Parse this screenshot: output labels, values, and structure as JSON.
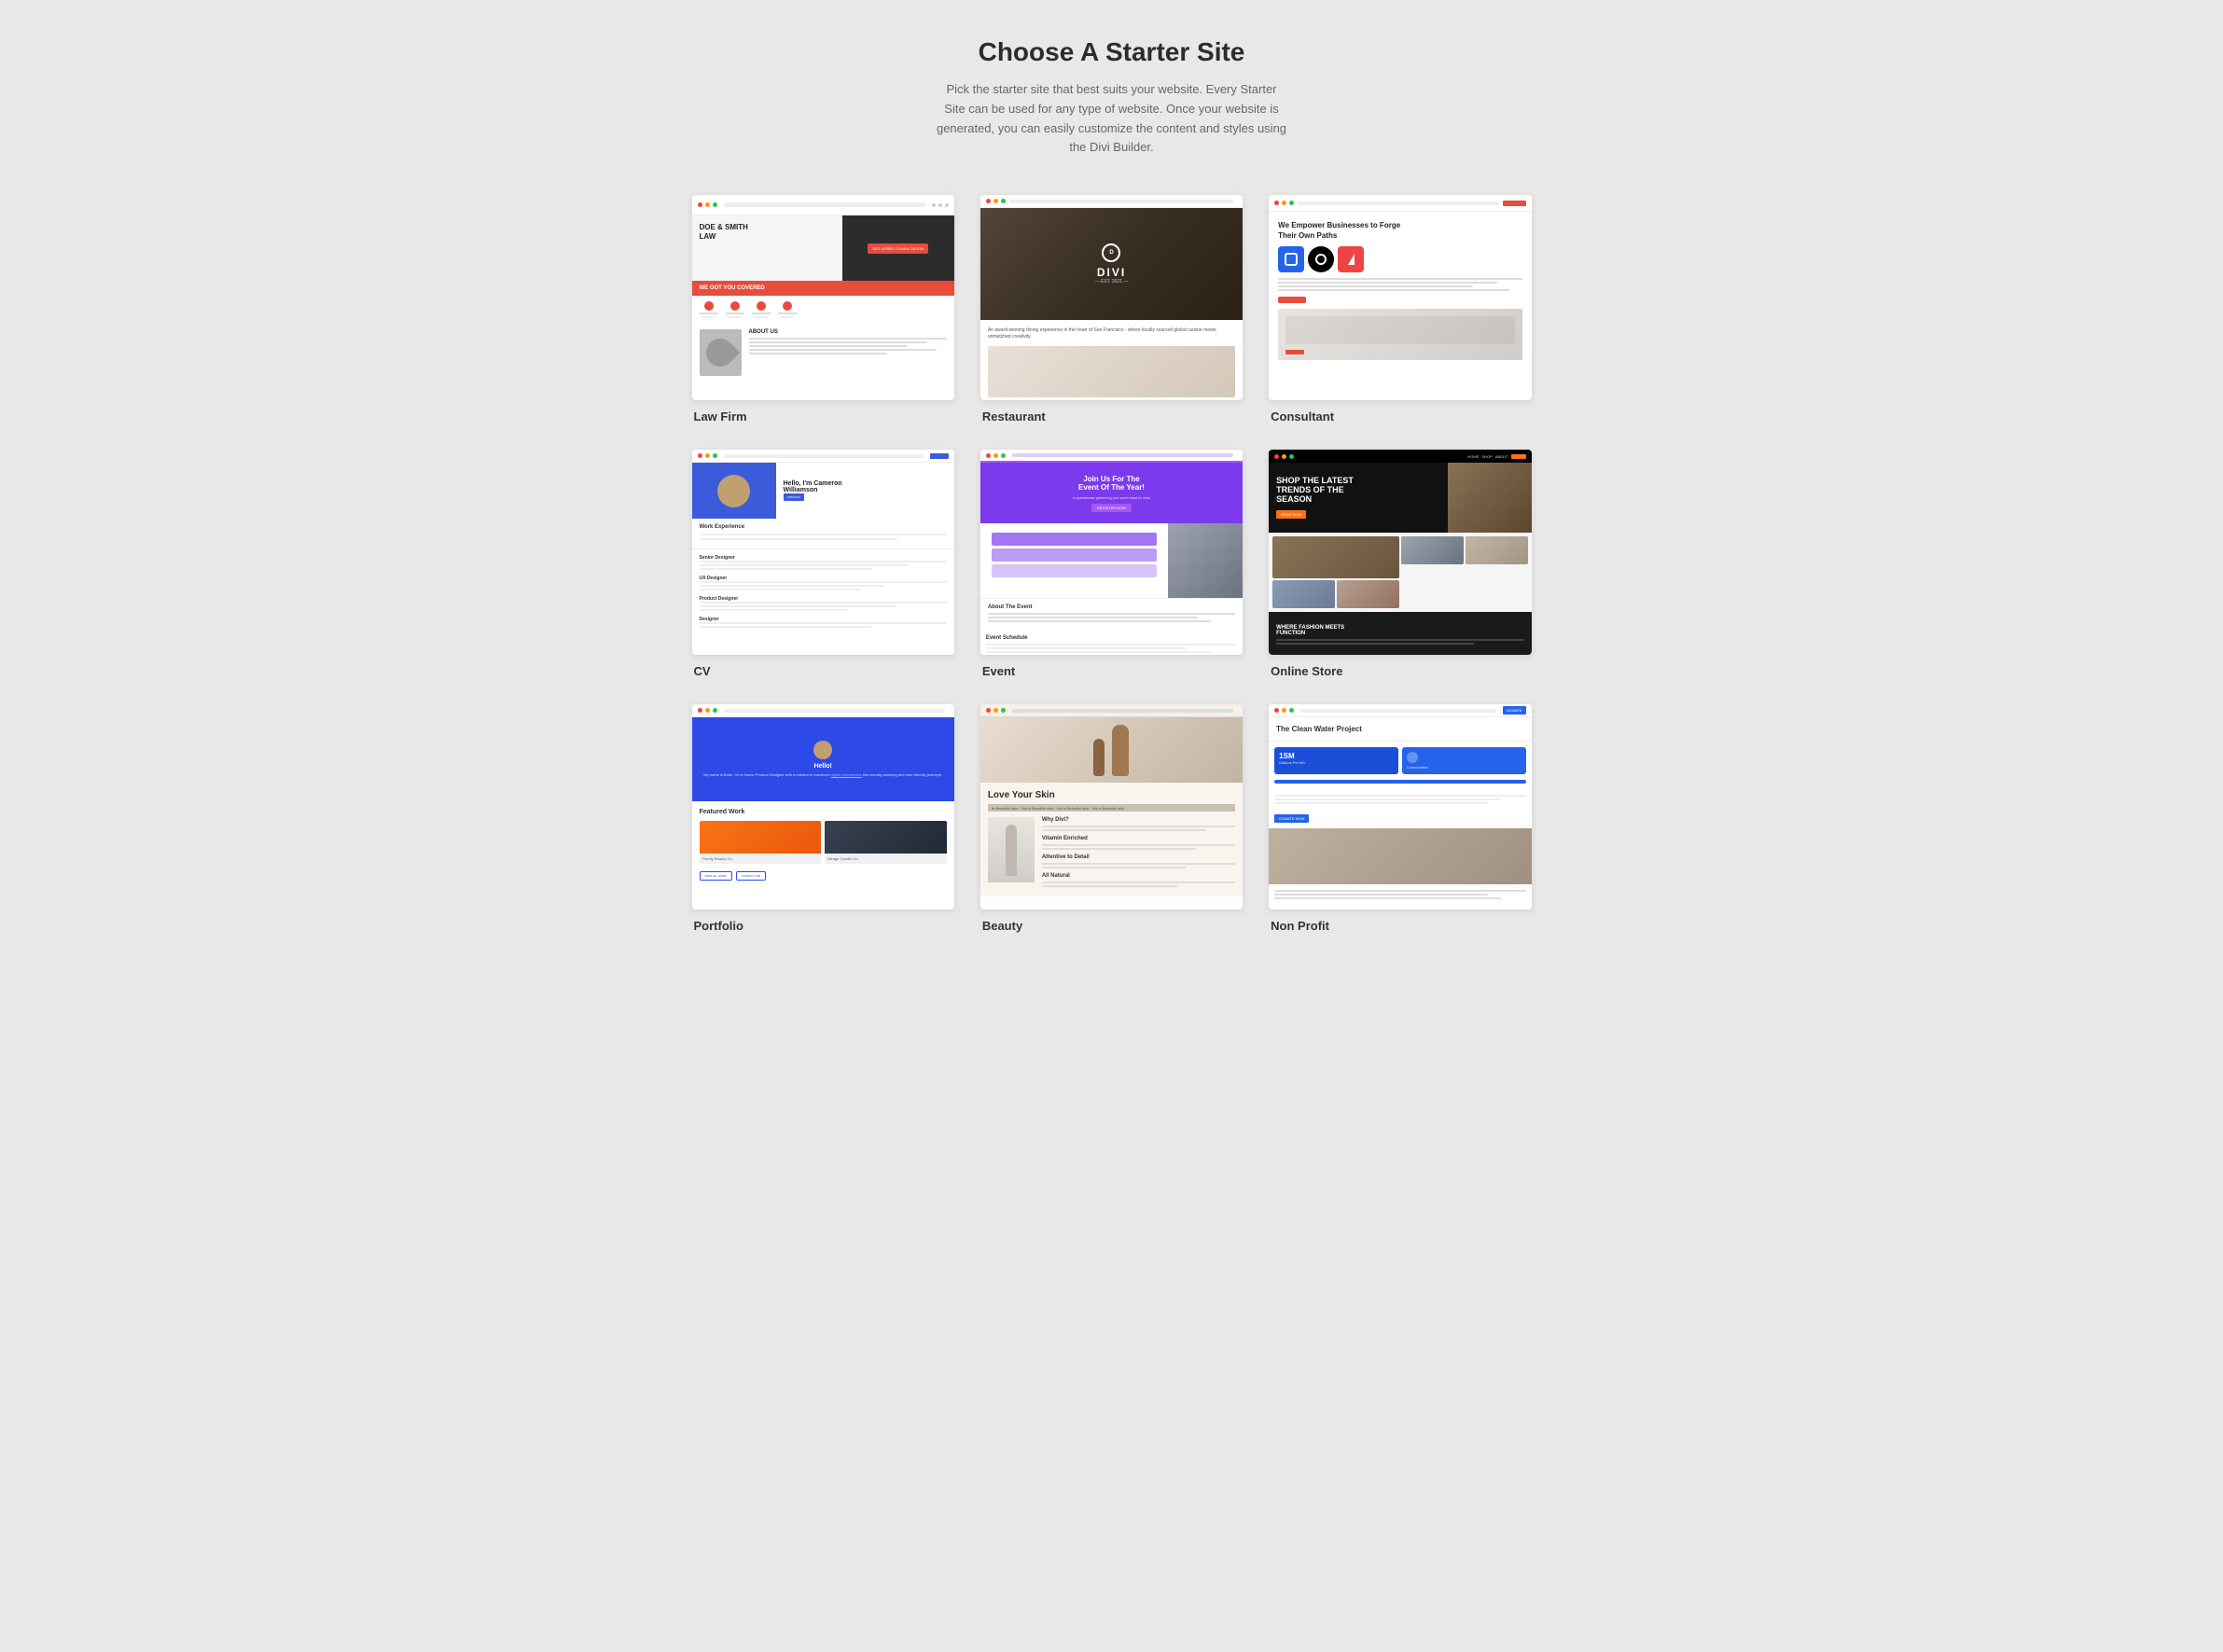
{
  "page": {
    "title": "Choose A Starter Site",
    "subtitle": "Pick the starter site that best suits your website. Every Starter Site can be used for any type of website. Once your website is generated, you can easily customize the content and styles using the Divi Builder."
  },
  "sites": [
    {
      "id": "law-firm",
      "label": "Law Firm"
    },
    {
      "id": "restaurant",
      "label": "Restaurant"
    },
    {
      "id": "consultant",
      "label": "Consultant"
    },
    {
      "id": "cv",
      "label": "CV"
    },
    {
      "id": "event",
      "label": "Event"
    },
    {
      "id": "online-store",
      "label": "Online Store"
    },
    {
      "id": "portfolio",
      "label": "Portfolio"
    },
    {
      "id": "beauty",
      "label": "Beauty"
    },
    {
      "id": "non-profit",
      "label": "Non Profit"
    }
  ]
}
